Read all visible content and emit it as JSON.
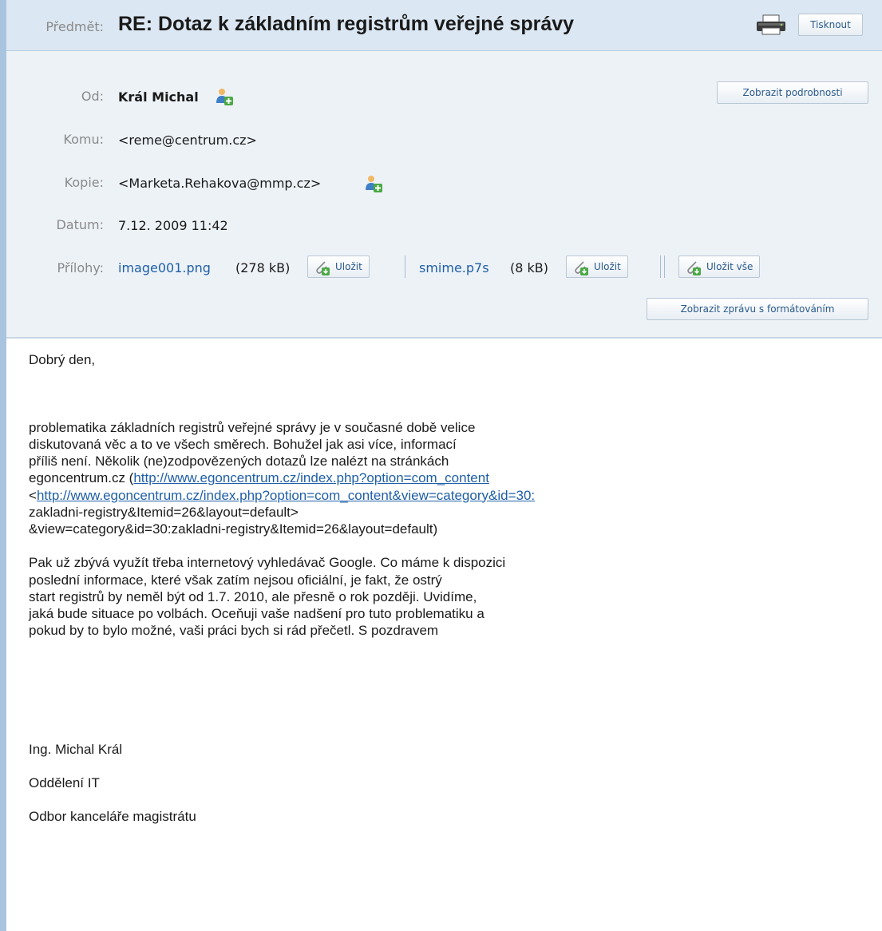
{
  "subject": {
    "label": "Předmět:",
    "text": "RE: Dotaz k základním registrům veřejné správy",
    "print_label": "Tisknout"
  },
  "header": {
    "from_label": "Od:",
    "from_name": "Král Michal",
    "details_label": "Zobrazit podrobnosti",
    "to_label": "Komu:",
    "to_value": "<reme@centrum.cz>",
    "cc_label": "Kopie:",
    "cc_value": "<Marketa.Rehakova@mmp.cz>",
    "date_label": "Datum:",
    "date_value": "7.12. 2009 11:42",
    "attachments_label": "Přílohy:",
    "attachments": [
      {
        "name": "image001.png",
        "size": "(278 kB)",
        "save_label": "Uložit"
      },
      {
        "name": "smime.p7s",
        "size": "(8 kB)",
        "save_label": "Uložit"
      }
    ],
    "save_all_label": "Uložit vše",
    "show_formatted_label": "Zobrazit zprávu s formátováním"
  },
  "body": {
    "greeting": "Dobrý den,",
    "p1_l1": "problematika základních registrů veřejné správy je v současné době velice",
    "p1_l2": "diskutovaná věc a to ve všech směrech. Bohužel jak asi více, informací",
    "p1_l3": "příliš není. Několik (ne)zodpovězených dotazů lze nalézt na stránkách",
    "p1_l4_pre": "egoncentrum.cz (",
    "p1_link1": "http://www.egoncentrum.cz/index.php?option=com_content",
    "p1_l5_pre": "<",
    "p1_link2": "http://www.egoncentrum.cz/index.php?option=com_content&view=category&id=30:",
    "p1_l6": "zakladni-registry&Itemid=26&layout=default>",
    "p1_l7": "&view=category&id=30:zakladni-registry&Itemid=26&layout=default)",
    "p2_l1": "Pak už zbývá využít třeba internetový vyhledávač Google. Co máme k dispozici",
    "p2_l2": "poslední informace, které však zatím nejsou oficiální, je fakt, že ostrý",
    "p2_l3": "start registrů by neměl být od 1.7. 2010, ale přesně o rok později. Uvidíme,",
    "p2_l4": "jaká bude situace po volbách. Oceňuji vaše nadšení pro tuto problematiku a",
    "p2_l5": "pokud by to bylo možné, vaši práci bych si rád přečetl. S pozdravem",
    "sig_name": "Ing. Michal Král",
    "sig_dept": "Oddělení IT",
    "sig_office": "Odbor kanceláře magistrátu"
  }
}
